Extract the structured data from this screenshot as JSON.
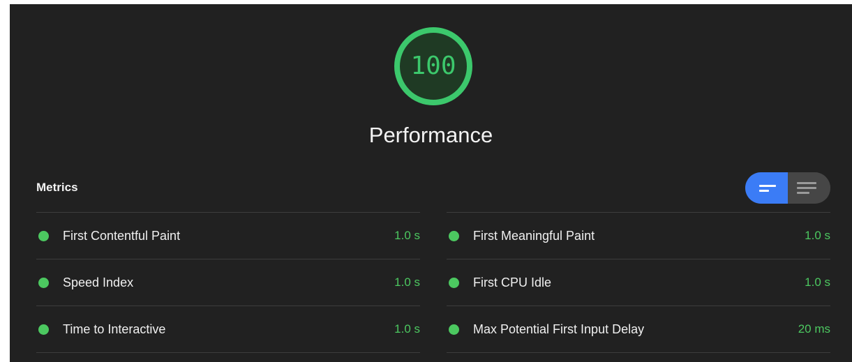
{
  "score": {
    "value": "100",
    "color": "#3cc86c",
    "fraction": 1.0
  },
  "category": {
    "title": "Performance"
  },
  "metrics": {
    "header": "Metrics",
    "view_toggle": {
      "options": [
        "opportunity-view-icon",
        "list-view-icon"
      ],
      "selected": "opportunity-view-icon",
      "accent": "#3b7cf6"
    },
    "left": [
      {
        "label": "First Contentful Paint",
        "value": "1.0 s",
        "status": "pass"
      },
      {
        "label": "Speed Index",
        "value": "1.0 s",
        "status": "pass"
      },
      {
        "label": "Time to Interactive",
        "value": "1.0 s",
        "status": "pass"
      }
    ],
    "right": [
      {
        "label": "First Meaningful Paint",
        "value": "1.0 s",
        "status": "pass"
      },
      {
        "label": "First CPU Idle",
        "value": "1.0 s",
        "status": "pass"
      },
      {
        "label": "Max Potential First Input Delay",
        "value": "20 ms",
        "status": "pass"
      }
    ],
    "pass_color": "#4cc860"
  }
}
